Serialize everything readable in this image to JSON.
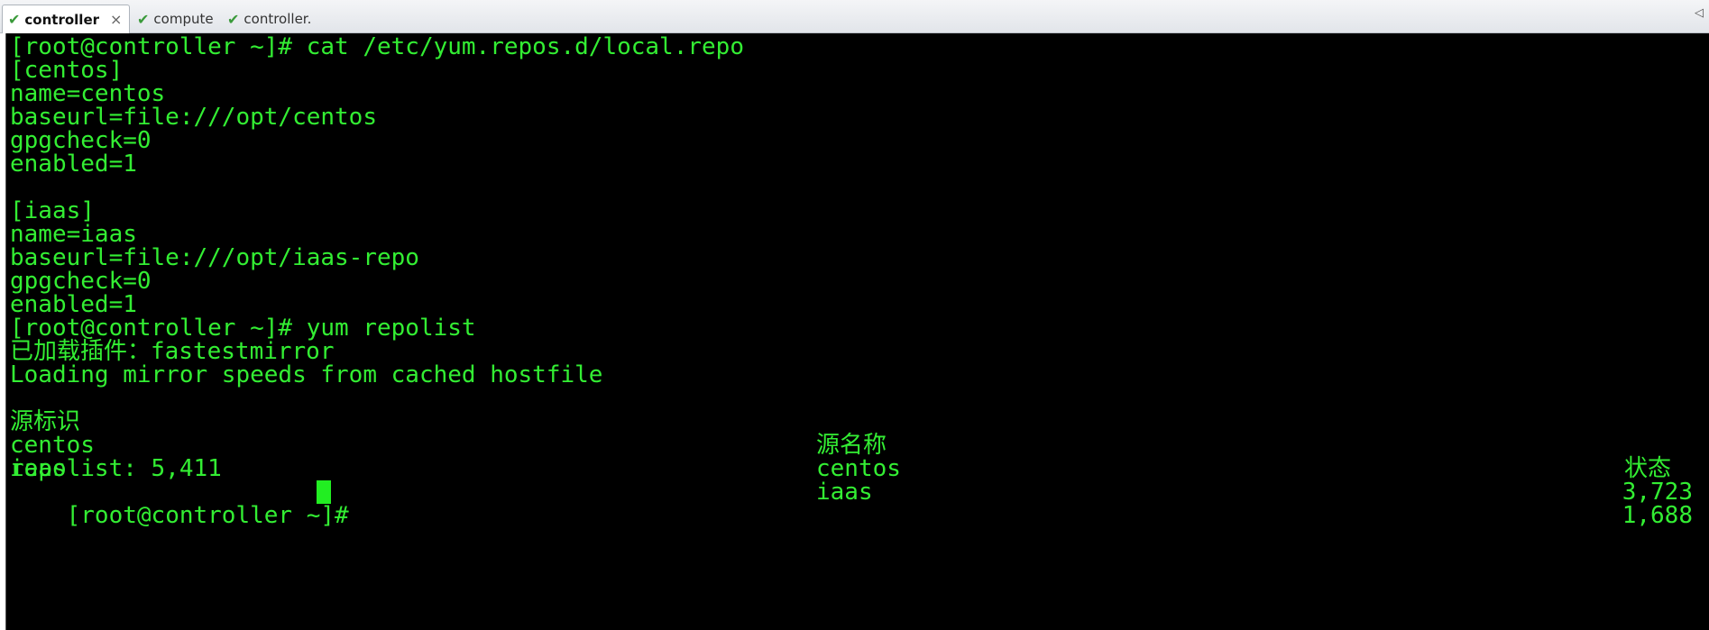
{
  "tabs": [
    {
      "label": "controller",
      "active": true
    },
    {
      "label": "compute",
      "active": false
    },
    {
      "label": "controller.",
      "active": false
    }
  ],
  "terminal": {
    "colors": {
      "background": "#000000",
      "text": "#33ee33",
      "cursor": "#22ee22"
    },
    "lines": [
      "[root@controller ~]# cat /etc/yum.repos.d/local.repo",
      "[centos]",
      "name=centos",
      "baseurl=file:///opt/centos",
      "gpgcheck=0",
      "enabled=1",
      "",
      "[iaas]",
      "name=iaas",
      "baseurl=file:///opt/iaas-repo",
      "gpgcheck=0",
      "enabled=1",
      "[root@controller ~]# yum repolist",
      "已加载插件：fastestmirror",
      "Loading mirror speeds from cached hostfile"
    ],
    "repo_table": {
      "headers": [
        "源标识",
        "源名称",
        "状态"
      ],
      "rows": [
        [
          "centos",
          "centos",
          "3,723"
        ],
        [
          "iaas",
          "iaas",
          "1,688"
        ]
      ]
    },
    "summary": "repolist: 5,411",
    "prompt": "[root@controller ~]# "
  }
}
